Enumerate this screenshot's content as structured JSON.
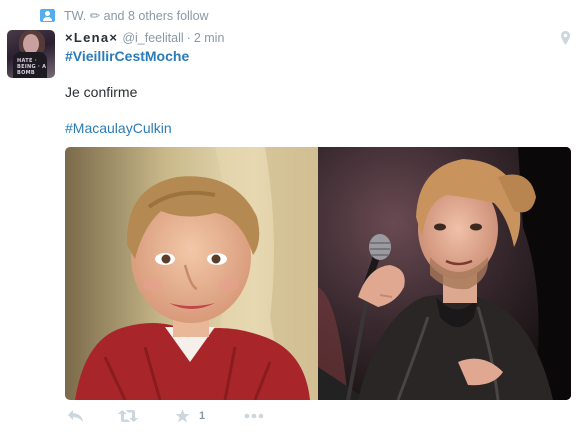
{
  "context": {
    "text": "TW. ✏ and 8 others follow",
    "icon": "follow-person-icon"
  },
  "tweet": {
    "fullname": "×Lena×",
    "username": "@i_feelitall",
    "separator": "·",
    "time": "2 min",
    "hashtag1": "#VieillirCestMoche",
    "body": "Je confirme",
    "hashtag2": "#MacaulayCulkin",
    "avatar_text": "HATE · BEING · A BOMB"
  },
  "actions": {
    "reply_icon": "reply-icon",
    "retweet_icon": "retweet-icon",
    "favorite_icon": "star-icon",
    "favorite_count": "1",
    "more_icon": "more-dots-icon"
  },
  "colors": {
    "link": "#2b7bb9",
    "muted": "#8899a6",
    "text": "#292f33",
    "accent": "#55acee"
  }
}
